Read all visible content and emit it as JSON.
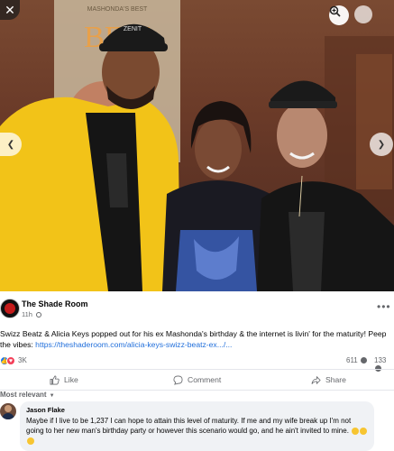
{
  "viewer": {
    "close_glyph": "✕",
    "zoom_icon": "zoom-in-icon",
    "options_icon": "options-icon",
    "prev_glyph": "❮",
    "next_glyph": "❯"
  },
  "photo": {
    "backdrop_text": "MASHONDA'S BEST",
    "backdrop_logo": "BEM",
    "cap_text": "ZENIT"
  },
  "post": {
    "page_name": "The Shade Room",
    "time": "11h",
    "caption_text": "Swizz Beatz & Alicia Keys popped out for his ex Mashonda's birthday & the internet is livin' for the maturity! Peep the vibes: ",
    "caption_link": "https://theshaderoom.com/alicia-keys-swizz-beatz-ex.../...",
    "reaction_count": "3K",
    "comment_count": "611",
    "share_count": "133",
    "more_glyph": "•••"
  },
  "actions": {
    "like_label": "Like",
    "comment_label": "Comment",
    "share_label": "Share"
  },
  "comments": {
    "sort_label": "Most relevant",
    "first": {
      "author": "Jason Flake",
      "text": "Maybe if I live to be 1,237 I can hope to attain this level of maturity. If me and my wife break up I'm not going to her new man's birthday party or however this scenario would go, and he ain't invited to mine."
    }
  },
  "colors": {
    "link": "#216fdb",
    "like_blue": "#1877f2",
    "love_red": "#f33e58",
    "jacket_yellow": "#f2c318"
  }
}
